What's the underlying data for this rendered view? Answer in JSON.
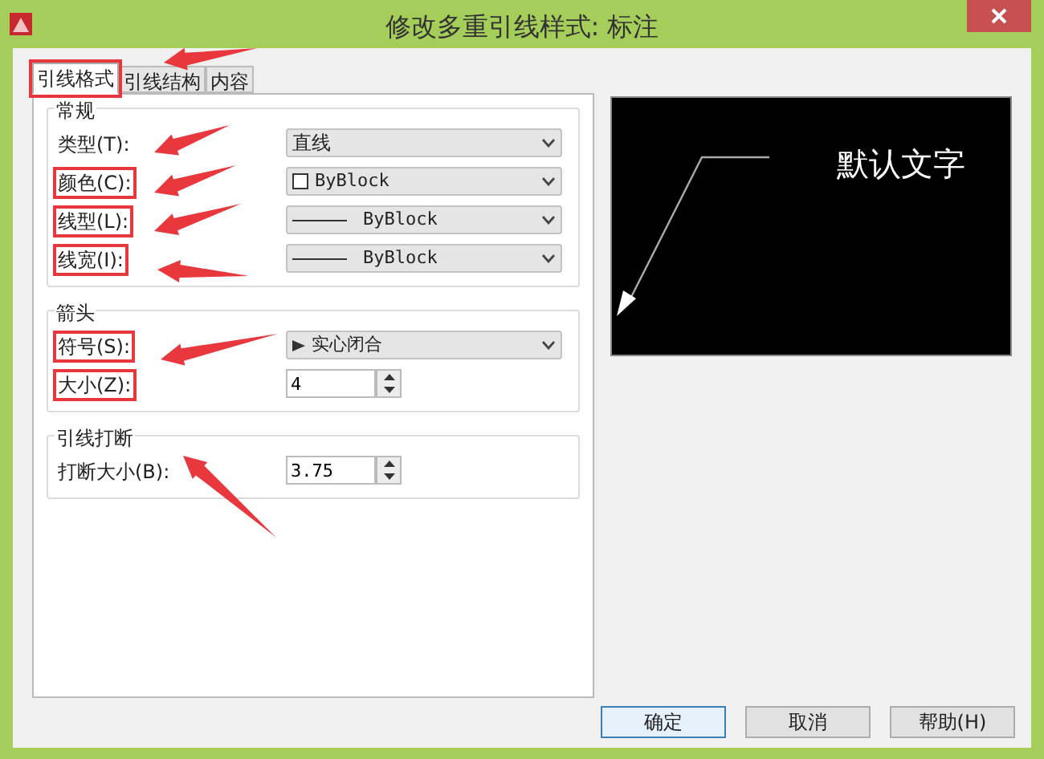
{
  "window": {
    "title": "修改多重引线样式: 标注"
  },
  "tabs": [
    {
      "label": "引线格式",
      "selected": true,
      "highlighted": true
    },
    {
      "label": "引线结构",
      "selected": false,
      "highlighted": false
    },
    {
      "label": "内容",
      "selected": false,
      "highlighted": false
    }
  ],
  "groups": [
    {
      "title": "常规",
      "rows": [
        {
          "label": "类型(T):",
          "kind": "select",
          "value": "直线",
          "highlighted": false
        },
        {
          "label": "颜色(C):",
          "kind": "select",
          "value": "ByBlock",
          "swatch": true,
          "highlighted": true
        },
        {
          "label": "线型(L):",
          "kind": "select",
          "value": "ByBlock",
          "line": true,
          "highlighted": true
        },
        {
          "label": "线宽(I):",
          "kind": "select",
          "value": "ByBlock",
          "line": true,
          "highlighted": true
        }
      ]
    },
    {
      "title": "箭头",
      "rows": [
        {
          "label": "符号(S):",
          "kind": "select",
          "value": "实心闭合",
          "arrow": true,
          "highlighted": true
        },
        {
          "label": "大小(Z):",
          "kind": "spinner",
          "value": "4",
          "highlighted": true
        }
      ]
    },
    {
      "title": "引线打断",
      "rows": [
        {
          "label": "打断大小(B):",
          "kind": "spinner",
          "value": "3.75",
          "highlighted": false
        }
      ]
    }
  ],
  "preview": {
    "text": "默认文字"
  },
  "buttons": [
    {
      "label": "确定",
      "default": true
    },
    {
      "label": "取消",
      "default": false
    },
    {
      "label": "帮助(H)",
      "default": false
    }
  ]
}
